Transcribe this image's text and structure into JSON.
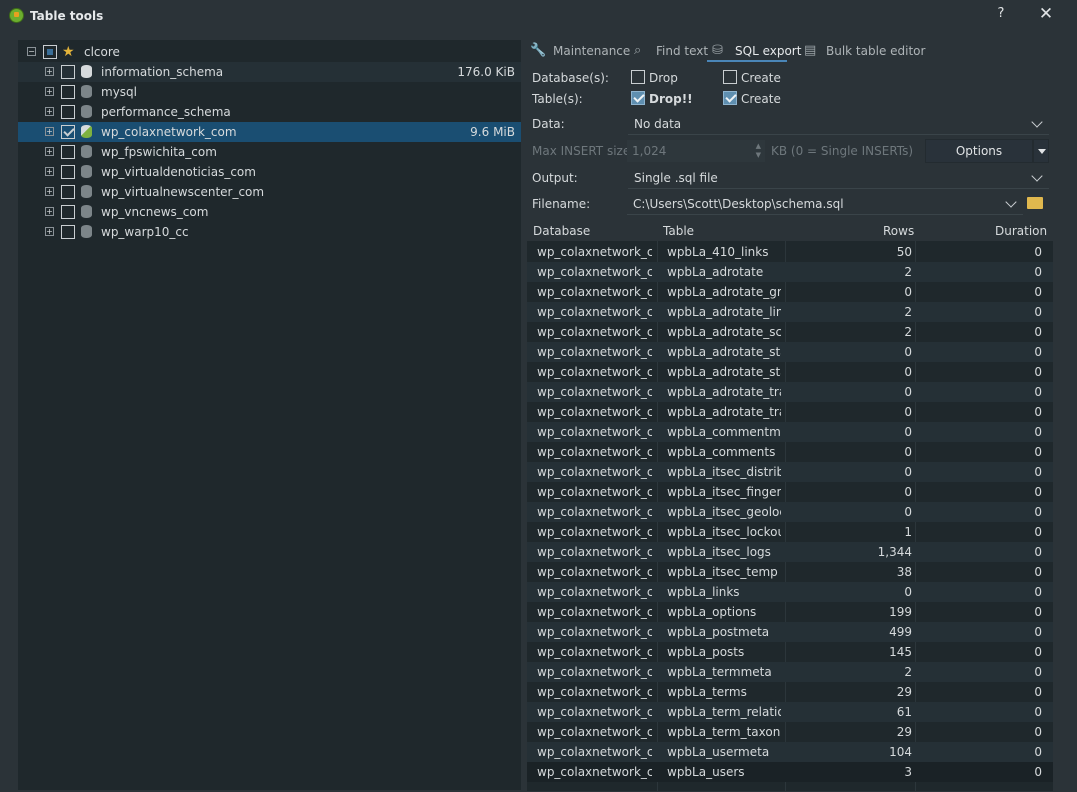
{
  "window": {
    "title": "Table tools",
    "help": "?",
    "close": "✕"
  },
  "tree": {
    "root": {
      "label": "clcore"
    },
    "items": [
      {
        "label": "information_schema",
        "size": "176.0 KiB"
      },
      {
        "label": "mysql",
        "size": ""
      },
      {
        "label": "performance_schema",
        "size": ""
      },
      {
        "label": "wp_colaxnetwork_com",
        "size": "9.6 MiB"
      },
      {
        "label": "wp_fpswichita_com",
        "size": ""
      },
      {
        "label": "wp_virtualdenoticias_com",
        "size": ""
      },
      {
        "label": "wp_virtualnewscenter_com",
        "size": ""
      },
      {
        "label": "wp_vncnews_com",
        "size": ""
      },
      {
        "label": "wp_warp10_cc",
        "size": ""
      }
    ]
  },
  "tabs": [
    "Maintenance",
    "Find text",
    "SQL export",
    "Bulk table editor"
  ],
  "form": {
    "databases_label": "Database(s):",
    "tables_label": "Table(s):",
    "drop": "Drop",
    "create": "Create",
    "drop_tables": "Drop!!",
    "create_tables": "Create",
    "data_label": "Data:",
    "data_value": "No data",
    "max_insert_label": "Max INSERT size:",
    "max_insert_value": "1,024",
    "kb_note": "KB (0 = Single INSERTs)",
    "options_button": "Options",
    "output_label": "Output:",
    "output_value": "Single .sql file",
    "filename_label": "Filename:",
    "filename_value": "C:\\Users\\Scott\\Desktop\\schema.sql"
  },
  "grid": {
    "columns": [
      "Database",
      "Table",
      "Rows",
      "Duration"
    ],
    "rows": [
      [
        "wp_colaxnetwork_c...",
        "wpbLa_410_links",
        "50",
        "0"
      ],
      [
        "wp_colaxnetwork_c...",
        "wpbLa_adrotate",
        "2",
        "0"
      ],
      [
        "wp_colaxnetwork_c...",
        "wpbLa_adrotate_gr...",
        "0",
        "0"
      ],
      [
        "wp_colaxnetwork_c...",
        "wpbLa_adrotate_lin...",
        "2",
        "0"
      ],
      [
        "wp_colaxnetwork_c...",
        "wpbLa_adrotate_sc...",
        "2",
        "0"
      ],
      [
        "wp_colaxnetwork_c...",
        "wpbLa_adrotate_stats",
        "0",
        "0"
      ],
      [
        "wp_colaxnetwork_c...",
        "wpbLa_adrotate_sta...",
        "0",
        "0"
      ],
      [
        "wp_colaxnetwork_c...",
        "wpbLa_adrotate_tra...",
        "0",
        "0"
      ],
      [
        "wp_colaxnetwork_c...",
        "wpbLa_adrotate_tra...",
        "0",
        "0"
      ],
      [
        "wp_colaxnetwork_c...",
        "wpbLa_commentm...",
        "0",
        "0"
      ],
      [
        "wp_colaxnetwork_c...",
        "wpbLa_comments",
        "0",
        "0"
      ],
      [
        "wp_colaxnetwork_c...",
        "wpbLa_itsec_distrib...",
        "0",
        "0"
      ],
      [
        "wp_colaxnetwork_c...",
        "wpbLa_itsec_finger...",
        "0",
        "0"
      ],
      [
        "wp_colaxnetwork_c...",
        "wpbLa_itsec_geoloc...",
        "0",
        "0"
      ],
      [
        "wp_colaxnetwork_c...",
        "wpbLa_itsec_lockouts",
        "1",
        "0"
      ],
      [
        "wp_colaxnetwork_c...",
        "wpbLa_itsec_logs",
        "1,344",
        "0"
      ],
      [
        "wp_colaxnetwork_c...",
        "wpbLa_itsec_temp",
        "38",
        "0"
      ],
      [
        "wp_colaxnetwork_c...",
        "wpbLa_links",
        "0",
        "0"
      ],
      [
        "wp_colaxnetwork_c...",
        "wpbLa_options",
        "199",
        "0"
      ],
      [
        "wp_colaxnetwork_c...",
        "wpbLa_postmeta",
        "499",
        "0"
      ],
      [
        "wp_colaxnetwork_c...",
        "wpbLa_posts",
        "145",
        "0"
      ],
      [
        "wp_colaxnetwork_c...",
        "wpbLa_termmeta",
        "2",
        "0"
      ],
      [
        "wp_colaxnetwork_c...",
        "wpbLa_terms",
        "29",
        "0"
      ],
      [
        "wp_colaxnetwork_c...",
        "wpbLa_term_relatio...",
        "61",
        "0"
      ],
      [
        "wp_colaxnetwork_c...",
        "wpbLa_term_taxono...",
        "29",
        "0"
      ],
      [
        "wp_colaxnetwork_c...",
        "wpbLa_usermeta",
        "104",
        "0"
      ],
      [
        "wp_colaxnetwork_c...",
        "wpbLa_users",
        "3",
        "0"
      ]
    ]
  }
}
